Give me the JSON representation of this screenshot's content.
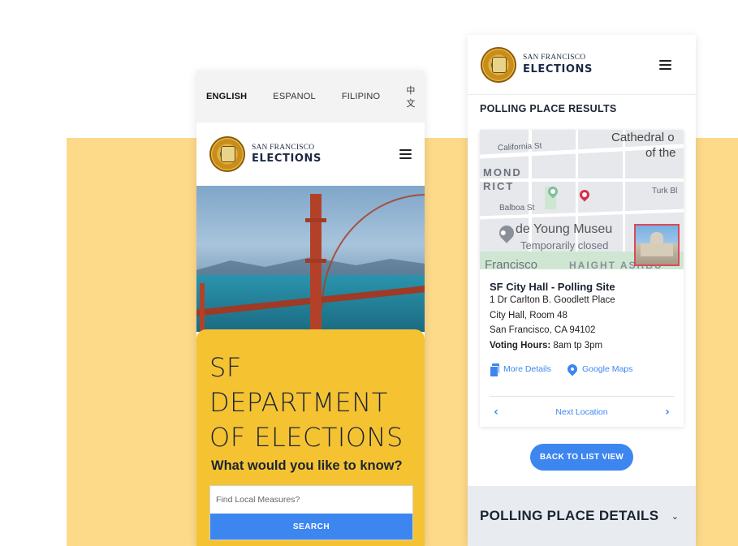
{
  "languages": [
    "ENGLISH",
    "ESPANOL",
    "FILIPINO",
    "中文"
  ],
  "brand": {
    "small": "SAN FRANCISCO",
    "big": "ELECTIONS"
  },
  "home": {
    "title_lines": [
      "SF",
      "DEPARTMENT",
      "OF ELECTIONS"
    ],
    "question": "What would you like to know?",
    "search_placeholder": "Find Local Measures?",
    "search_button": "SEARCH"
  },
  "results": {
    "heading": "POLLING PLACE RESULTS",
    "map_labels": {
      "cathedral": "Cathedral o",
      "of_the": "of the",
      "california": "California St",
      "mond": "MOND",
      "rict": "RICT",
      "balboa": "Balboa St",
      "turk": "Turk Bl",
      "deyoung": "de Young Museu",
      "closed": "Temporarily closed",
      "francisco": "Francisco",
      "haight": "HAIGHT ASHBU"
    },
    "place_name": "SF City Hall - Polling Site",
    "address_lines": [
      "1 Dr Carlton B. Goodlett Place",
      "City Hall, Room 48",
      "San Francisco, CA 94102"
    ],
    "hours_label": "Voting Hours:",
    "hours_value": " 8am tp 3pm",
    "more_details": "More Details",
    "google_maps": "Google Maps",
    "next_location": "Next Location",
    "back_button": "BACK TO LIST VIEW",
    "details_title": "POLLING PLACE DETAILS"
  },
  "colors": {
    "backdrop": "#fdd98a",
    "yellow_card": "#f5c332",
    "accent_blue": "#3d86f0",
    "navy": "#1b2433",
    "details_bg": "#e8ecf0"
  },
  "icons": [
    "hamburger-menu-icon",
    "city-seal-logo",
    "document-icon",
    "map-pin-icon",
    "chevron-left-icon",
    "chevron-right-icon",
    "chevron-down-icon"
  ]
}
